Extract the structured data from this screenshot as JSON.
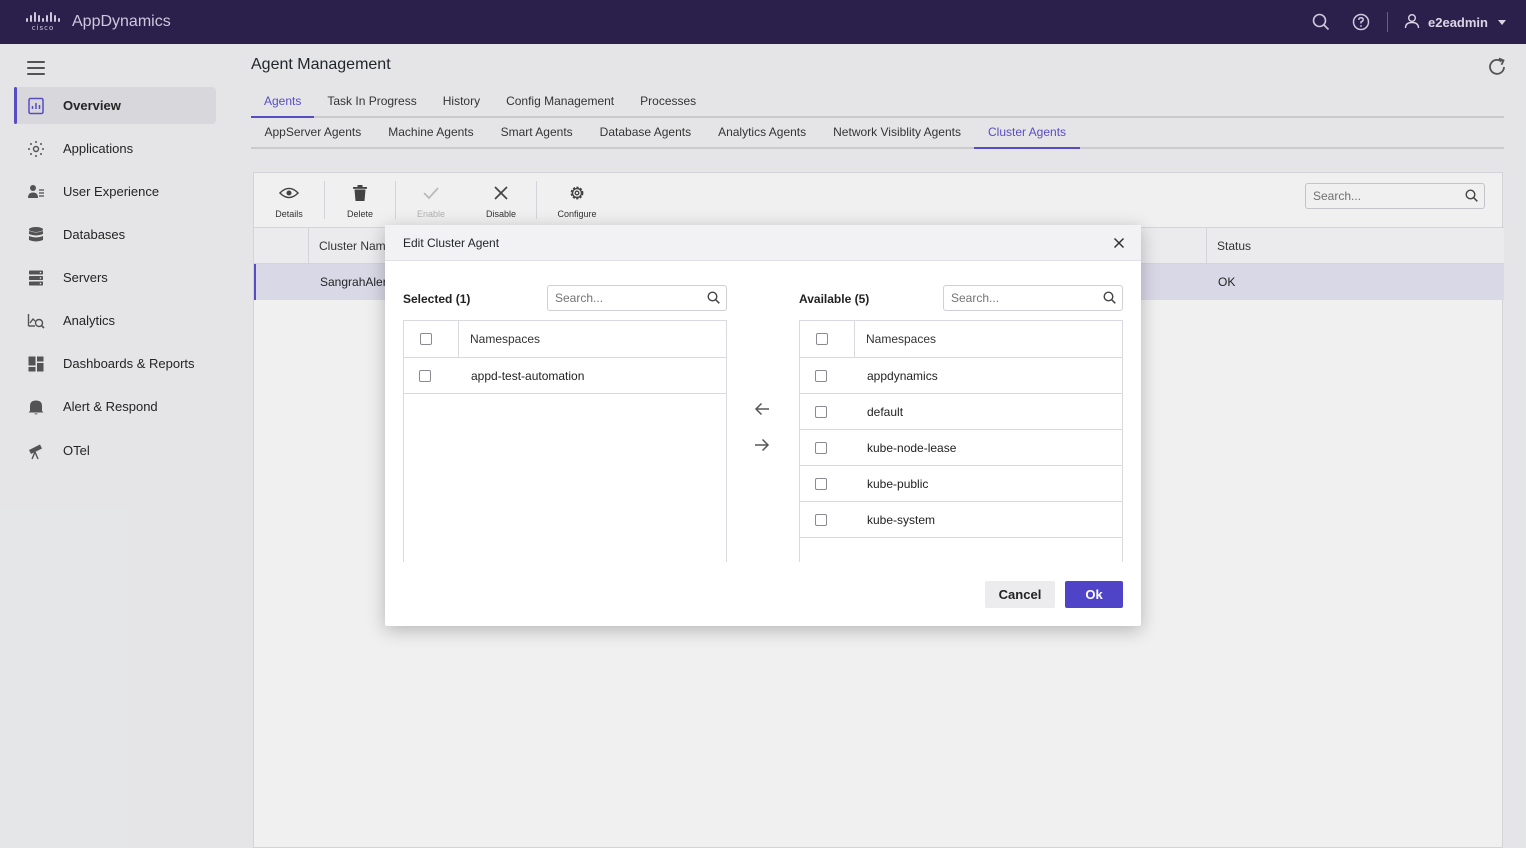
{
  "app": {
    "brand_mark": "cisco",
    "brand_name": "AppDynamics",
    "user_name": "e2eadmin",
    "accent_color": "#5a4fcf",
    "topbar_color": "#2a1e4e"
  },
  "sidebar": {
    "items": [
      {
        "label": "Overview",
        "icon": "overview-icon",
        "active": true
      },
      {
        "label": "Applications",
        "icon": "applications-icon"
      },
      {
        "label": "User Experience",
        "icon": "user-experience-icon"
      },
      {
        "label": "Databases",
        "icon": "databases-icon"
      },
      {
        "label": "Servers",
        "icon": "servers-icon"
      },
      {
        "label": "Analytics",
        "icon": "analytics-icon"
      },
      {
        "label": "Dashboards & Reports",
        "icon": "dashboards-icon"
      },
      {
        "label": "Alert & Respond",
        "icon": "bell-icon"
      },
      {
        "label": "OTel",
        "icon": "telescope-icon"
      }
    ]
  },
  "page": {
    "title": "Agent Management",
    "tabs": [
      "Agents",
      "Task In Progress",
      "History",
      "Config Management",
      "Processes"
    ],
    "active_tab": "Agents",
    "subtabs": [
      "AppServer Agents",
      "Machine Agents",
      "Smart Agents",
      "Database Agents",
      "Analytics Agents",
      "Network Visiblity Agents",
      "Cluster Agents"
    ],
    "active_subtab": "Cluster Agents"
  },
  "toolbar": {
    "details": "Details",
    "delete": "Delete",
    "enable": "Enable",
    "disable": "Disable",
    "configure": "Configure",
    "search_placeholder": "Search..."
  },
  "grid": {
    "columns": {
      "cluster_name": "Cluster Nam",
      "status": "Status"
    },
    "rows": [
      {
        "cluster_name": "SangrahAlert",
        "status": "OK"
      }
    ]
  },
  "modal": {
    "title": "Edit Cluster Agent",
    "selected": {
      "label": "Selected (1)",
      "search_placeholder": "Search...",
      "column": "Namespaces",
      "items": [
        "appd-test-automation"
      ]
    },
    "available": {
      "label": "Available (5)",
      "search_placeholder": "Search...",
      "column": "Namespaces",
      "items": [
        "appdynamics",
        "default",
        "kube-node-lease",
        "kube-public",
        "kube-system"
      ]
    },
    "cancel_label": "Cancel",
    "ok_label": "Ok"
  }
}
